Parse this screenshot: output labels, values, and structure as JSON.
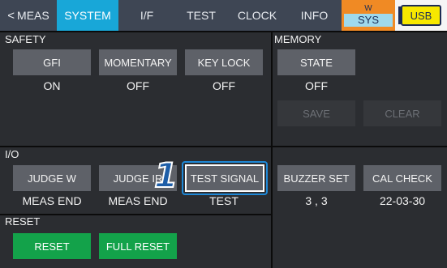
{
  "tabs": [
    {
      "label": "MEAS",
      "icon": "chevron-left-icon"
    },
    {
      "label": "SYSTEM"
    },
    {
      "label": "I/F"
    },
    {
      "label": "TEST"
    },
    {
      "label": "CLOCK"
    },
    {
      "label": "INFO"
    }
  ],
  "status": {
    "w": "W",
    "sys": "SYS",
    "usb": "USB"
  },
  "safety": {
    "title": "SAFETY",
    "items": [
      {
        "label": "GFI",
        "value": "ON"
      },
      {
        "label": "MOMENTARY",
        "value": "OFF"
      },
      {
        "label": "KEY LOCK",
        "value": "OFF"
      }
    ]
  },
  "memory": {
    "title": "MEMORY",
    "state": {
      "label": "STATE",
      "value": "OFF"
    },
    "save": "SAVE",
    "clear": "CLEAR"
  },
  "io": {
    "title": "I/O",
    "items": [
      {
        "label": "JUDGE W",
        "value": "MEAS END"
      },
      {
        "label": "JUDGE IR",
        "value": "MEAS END"
      },
      {
        "label": "TEST SIGNAL",
        "value": "TEST"
      }
    ],
    "right": [
      {
        "label": "BUZZER SET",
        "value": "3 , 3"
      },
      {
        "label": "CAL CHECK",
        "value": "22-03-30"
      }
    ]
  },
  "reset": {
    "title": "RESET",
    "reset": "RESET",
    "full_reset": "FULL RESET"
  },
  "callout": "1",
  "colors": {
    "active_tab": "#18a7d8",
    "green": "#13a24a",
    "highlight": "#1e88d6",
    "status_orange": "#f08a24",
    "usb_yellow": "#f7e800"
  }
}
